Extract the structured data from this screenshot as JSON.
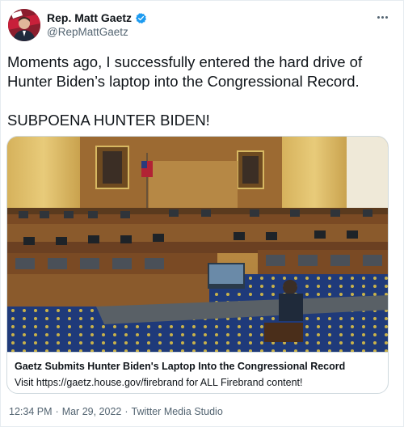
{
  "author": {
    "display_name": "Rep. Matt Gaetz",
    "handle": "@RepMattGaetz",
    "verified": true
  },
  "tweet": {
    "text": "Moments ago, I successfully entered the hard drive of Hunter Biden’s laptop into the Congressional Record.\n\nSUBPOENA HUNTER BIDEN!"
  },
  "card": {
    "title": "Gaetz Submits Hunter Biden's Laptop Into the Congressional Record",
    "description": "Visit https://gaetz.house.gov/firebrand for ALL Firebrand content!"
  },
  "meta": {
    "time": "12:34 PM",
    "separator1": "·",
    "date": "Mar 29, 2022",
    "separator2": "·",
    "source": "Twitter Media Studio"
  },
  "icons": {
    "verified": "verified-badge-icon",
    "more": "more-options-icon"
  },
  "colors": {
    "verified_blue": "#1d9bf0",
    "secondary_text": "#536471",
    "border": "#cfd9de"
  }
}
